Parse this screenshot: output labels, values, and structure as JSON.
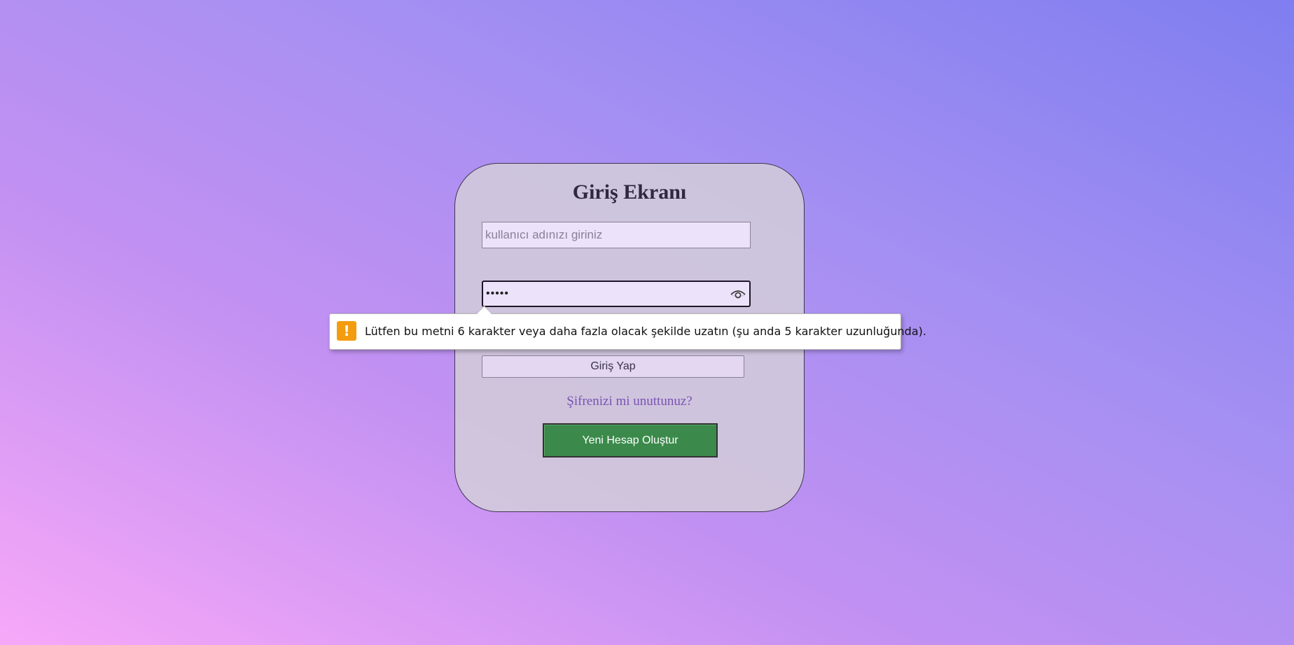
{
  "login_card": {
    "title": "Giriş Ekranı",
    "username_placeholder": "kullanıcı adınızı giriniz",
    "password_value": "12345",
    "login_button_label": "Giriş Yap",
    "forgot_link_label": "Şifrenizi mi unuttunuz?",
    "create_account_label": "Yeni Hesap Oluştur"
  },
  "validation_tooltip": {
    "icon": "warning-icon",
    "message": "Lütfen bu metni 6 karakter veya daha fazla olacak şekilde uzatın (şu anda 5 karakter uzunluğunda)."
  },
  "colors": {
    "create_button": "#3b8a4b",
    "warning": "#f49c0f",
    "link": "#7a52b4"
  }
}
